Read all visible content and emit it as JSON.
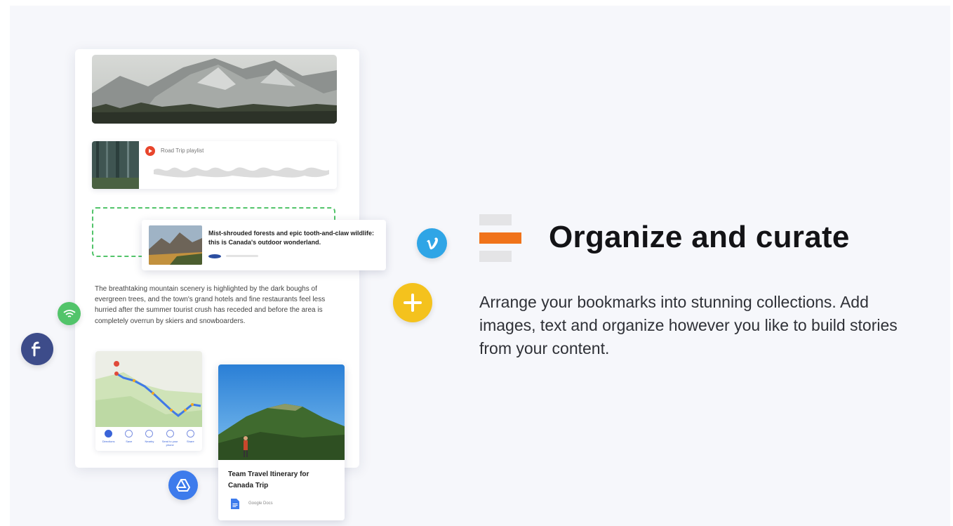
{
  "playlist": {
    "label": "Road Trip playlist"
  },
  "link_card": {
    "title": "Mist-shrouded forests and epic tooth-and-claw wildlife: this is Canada's outdoor wonderland."
  },
  "note": {
    "text": "The breathtaking mountain scenery is highlighted by the dark boughs of evergreen trees, and the town's grand hotels and fine restaurants feel less hurried after the summer tourist crush has receded and before the area is completely overrun by skiers and snowboarders."
  },
  "map": {
    "actions": [
      "Directions",
      "Save",
      "Nearby",
      "Send to your phone",
      "Share"
    ]
  },
  "doc_card": {
    "title": "Team Travel Itinerary for Canada Trip",
    "source": "Google Docs"
  },
  "feature": {
    "title": "Organize and curate",
    "description": "Arrange your bookmarks into stunning collections. Add images, text and organize however you like to build stories from your content."
  },
  "colors": {
    "accent_orange": "#f0731a",
    "green": "#52c46a",
    "vimeo_blue": "#2fa5e6",
    "yellow": "#f4c21d",
    "navy": "#3d4c8a",
    "drive_blue": "#3d7bec"
  },
  "icons": [
    "vimeo-icon",
    "plus-icon",
    "wifi-icon",
    "feedly-icon",
    "drive-icon",
    "organize-icon",
    "play-icon",
    "docs-icon"
  ]
}
